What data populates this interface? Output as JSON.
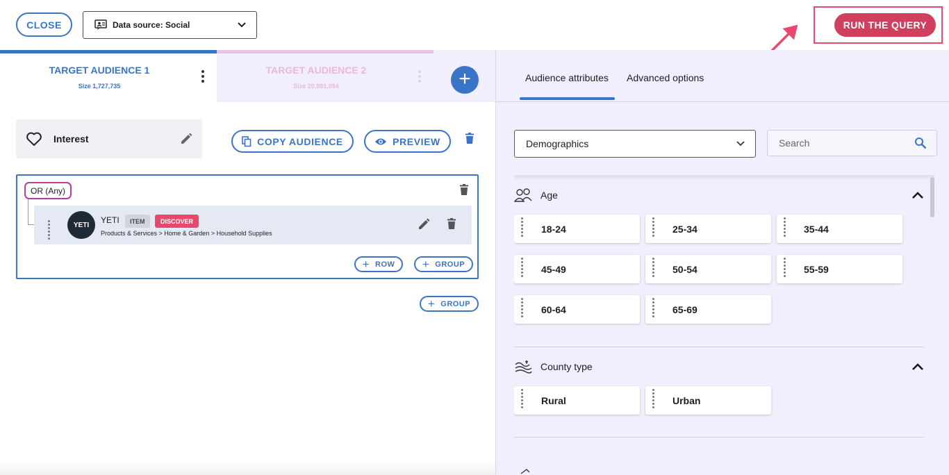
{
  "header": {
    "close_label": "CLOSE",
    "data_source_label": "Data source: Social",
    "run_query_label": "RUN THE QUERY"
  },
  "tabs": [
    {
      "title": "TARGET AUDIENCE 1",
      "size": "Size 1,727,735"
    },
    {
      "title": "TARGET AUDIENCE 2",
      "size": "Size 20,991,054"
    }
  ],
  "criteria": {
    "interest_label": "Interest",
    "copy_label": "COPY AUDIENCE",
    "preview_label": "PREVIEW",
    "logic_label": "OR (Any)",
    "item": {
      "logo_text": "YETI",
      "name": "YETI",
      "badge_type": "ITEM",
      "badge_action": "DISCOVER",
      "path": "Products & Services > Home & Garden > Household Supplies"
    },
    "row_label": "ROW",
    "group_label": "GROUP",
    "group_label_outer": "GROUP"
  },
  "attributes": {
    "tab_1": "Audience attributes",
    "tab_2": "Advanced options",
    "category_select": "Demographics",
    "search_placeholder": "Search",
    "sections": [
      {
        "title": "Age",
        "icon": "people-age-icon",
        "options": [
          "18-24",
          "25-34",
          "35-44",
          "45-49",
          "50-54",
          "55-59",
          "60-64",
          "65-69"
        ]
      },
      {
        "title": "County type",
        "icon": "landscape-icon",
        "options": [
          "Rural",
          "Urban"
        ]
      }
    ]
  },
  "colors": {
    "accent": "#3a74c7",
    "run_button": "#d13f5e",
    "highlight": "#e8486b",
    "panel_bg": "#f1effd"
  }
}
